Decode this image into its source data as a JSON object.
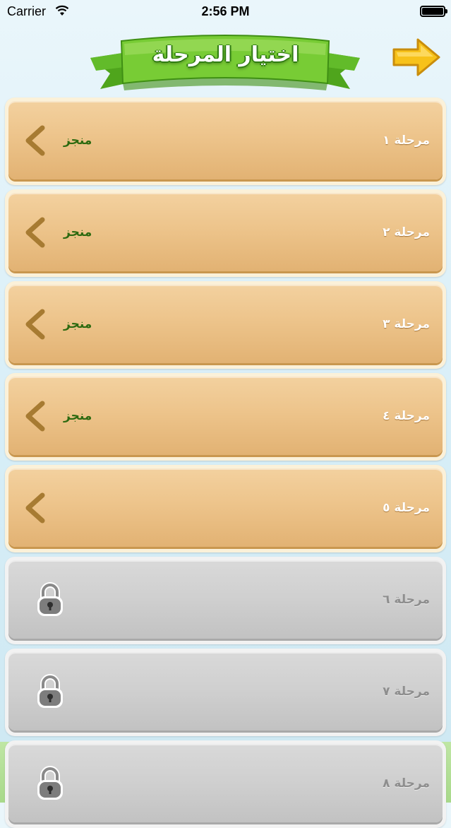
{
  "status_bar": {
    "carrier": "Carrier",
    "time": "2:56 PM"
  },
  "header": {
    "title": "اختيار المرحلة",
    "back_icon": "right-arrow-icon"
  },
  "levels": [
    {
      "name": "مرحلة ١",
      "status": "منجز",
      "state": "completed"
    },
    {
      "name": "مرحلة ٢",
      "status": "منجز",
      "state": "completed"
    },
    {
      "name": "مرحلة ٣",
      "status": "منجز",
      "state": "completed"
    },
    {
      "name": "مرحلة ٤",
      "status": "منجز",
      "state": "completed"
    },
    {
      "name": "مرحلة ٥",
      "status": "",
      "state": "unlocked"
    },
    {
      "name": "مرحلة ٦",
      "status": "",
      "state": "locked"
    },
    {
      "name": "مرحلة ٧",
      "status": "",
      "state": "locked"
    },
    {
      "name": "مرحلة ٨",
      "status": "",
      "state": "locked"
    }
  ],
  "colors": {
    "open_card": "#edc48b",
    "locked_card": "#cfcfcf",
    "done_text": "#2d6a10",
    "banner_green": "#6cc72e",
    "arrow_yellow": "#f7c21a"
  }
}
